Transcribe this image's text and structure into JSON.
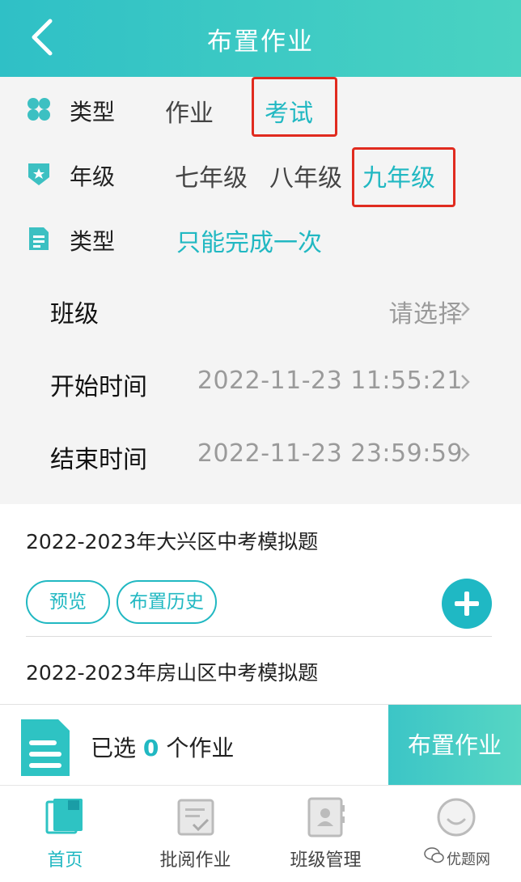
{
  "header": {
    "title": "布置作业",
    "back_icon": "chevron-left-icon"
  },
  "settings": {
    "type_row": {
      "label": "类型",
      "options": [
        "作业",
        "考试"
      ],
      "selected": "考试"
    },
    "grade_row": {
      "label": "年级",
      "options": [
        "七年级",
        "八年级",
        "九年级"
      ],
      "selected": "九年级"
    },
    "mode_row": {
      "label": "类型",
      "value": "只能完成一次"
    },
    "class_field": {
      "label": "班级",
      "value": "请选择"
    },
    "start_field": {
      "label": "开始时间",
      "value": "2022-11-23 11:55:21"
    },
    "end_field": {
      "label": "结束时间",
      "value": "2022-11-23 23:59:59"
    }
  },
  "list": {
    "items": [
      {
        "title": "2022-2023年大兴区中考模拟题",
        "preview_label": "预览",
        "history_label": "布置历史"
      },
      {
        "title": "2022-2023年房山区中考模拟题"
      }
    ]
  },
  "selection": {
    "prefix": "已选",
    "count": "0",
    "suffix": "个作业",
    "assign_label": "布置作业"
  },
  "tabs": [
    {
      "label": "首页",
      "icon": "home-icon",
      "active": true
    },
    {
      "label": "批阅作业",
      "icon": "grading-icon"
    },
    {
      "label": "班级管理",
      "icon": "class-contacts-icon"
    },
    {
      "label": "",
      "icon": "smiley-icon"
    }
  ],
  "watermark": {
    "text": "优题网"
  },
  "colors": {
    "accent": "#21b8c2",
    "highlight_border": "#e02b1f",
    "header_start": "#2fc0c6",
    "header_end": "#4ad3c2"
  }
}
